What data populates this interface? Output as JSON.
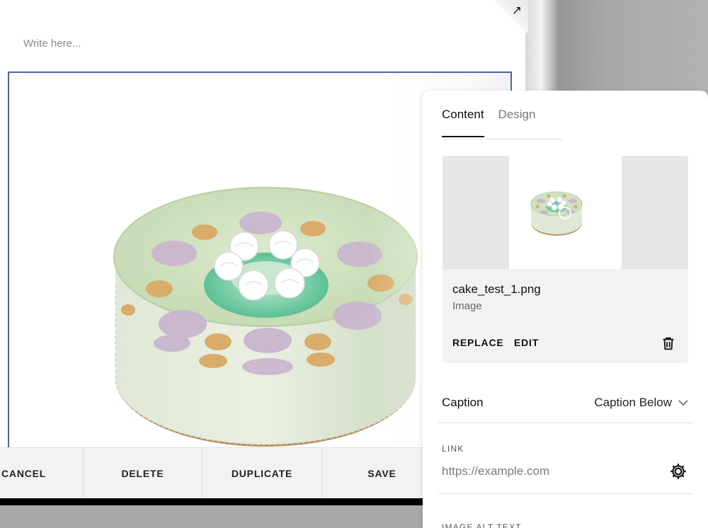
{
  "editor": {
    "placeholder": "Write here...",
    "expand_icon": "expand-arrow-icon"
  },
  "toolbar": {
    "cancel": "CANCEL",
    "delete": "DELETE",
    "duplicate": "DUPLICATE",
    "save": "SAVE"
  },
  "panel": {
    "tabs": [
      {
        "label": "Content",
        "active": true
      },
      {
        "label": "Design",
        "active": false
      }
    ],
    "media": {
      "file_name": "cake_test_1.png",
      "file_type": "Image",
      "replace_label": "REPLACE",
      "edit_label": "EDIT",
      "delete_icon": "trash-icon"
    },
    "caption": {
      "label": "Caption",
      "value": "Caption Below"
    },
    "link": {
      "label": "LINK",
      "placeholder": "https://example.com",
      "settings_icon": "gear-icon"
    },
    "alt_text": {
      "label": "IMAGE ALT TEXT"
    }
  },
  "colors": {
    "selection_border": "#4b63a9",
    "panel_background": "#ffffff",
    "card_background": "#f2f2f2",
    "cake_green": "#cfe2bf"
  }
}
